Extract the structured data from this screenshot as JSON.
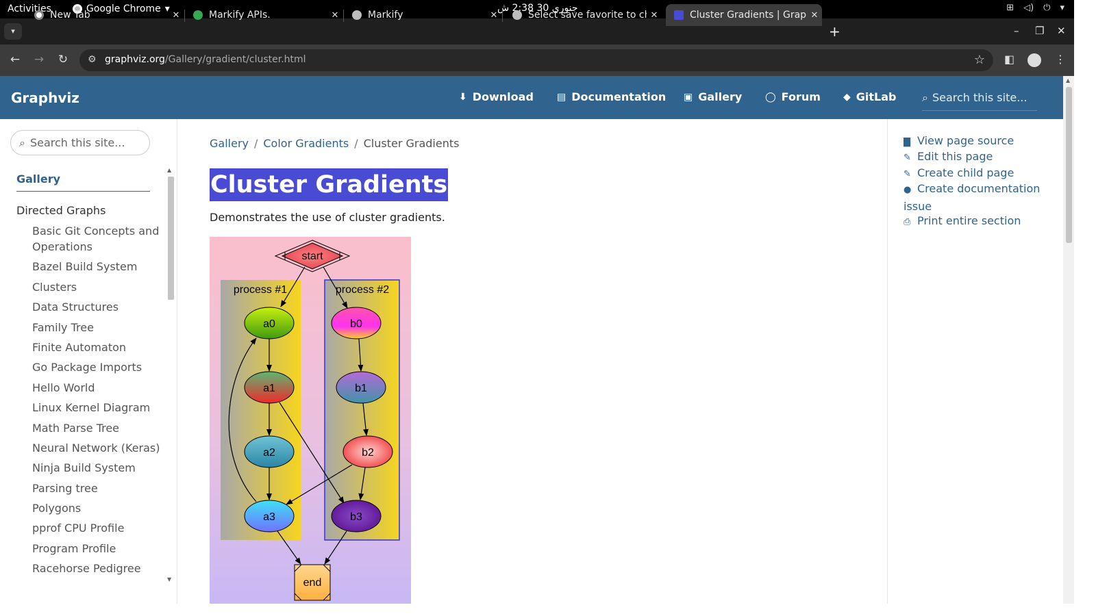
{
  "system": {
    "activities": "Activities",
    "app_name": "Google Chrome",
    "clock": "جنوری 30  2:38 ش"
  },
  "tabs": [
    {
      "title": "New Tab",
      "favicon_color": "#ffffff"
    },
    {
      "title": "Markify APIs.",
      "favicon_color": "#34a853"
    },
    {
      "title": "Markify",
      "favicon_color": "#bdbdbd"
    },
    {
      "title": "Select save favorite to ch",
      "favicon_color": "#bdbdbd"
    },
    {
      "title": "Cluster Gradients | Grapl",
      "favicon_color": "#4a4bd4"
    }
  ],
  "toolbar": {
    "url_host": "graphviz.org",
    "url_path": "/Gallery/gradient/cluster.html"
  },
  "site": {
    "brand": "Graphviz",
    "nav": [
      {
        "label": "Download",
        "icon": "download-icon"
      },
      {
        "label": "Documentation",
        "icon": "book-icon"
      },
      {
        "label": "Gallery",
        "icon": "images-icon"
      },
      {
        "label": "Forum",
        "icon": "chat-icon"
      },
      {
        "label": "GitLab",
        "icon": "gitlab-icon"
      }
    ],
    "search_placeholder": "Search this site..."
  },
  "sidebar": {
    "search_placeholder": "Search this site...",
    "section": "Gallery",
    "group": "Directed Graphs",
    "items": [
      "Basic Git Concepts and Operations",
      "Bazel Build System",
      "Clusters",
      "Data Structures",
      "Family Tree",
      "Finite Automaton",
      "Go Package Imports",
      "Hello World",
      "Linux Kernel Diagram",
      "Math Parse Tree",
      "Neural Network (Keras)",
      "Ninja Build System",
      "Parsing tree",
      "Polygons",
      "pprof CPU Profile",
      "Program Profile",
      "Racehorse Pedigree"
    ]
  },
  "main": {
    "breadcrumb": [
      "Gallery",
      "Color Gradients",
      "Cluster Gradients"
    ],
    "title": "Cluster Gradients",
    "lead": "Demonstrates the use of cluster gradients.",
    "graph": {
      "clusters": [
        "process #1",
        "process #2"
      ],
      "nodes": [
        "start",
        "a0",
        "a1",
        "a2",
        "a3",
        "b0",
        "b1",
        "b2",
        "b3",
        "end"
      ]
    }
  },
  "toc": [
    {
      "label": "View page source",
      "icon": "file-icon"
    },
    {
      "label": "Edit this page",
      "icon": "edit-icon"
    },
    {
      "label": "Create child page",
      "icon": "edit-icon"
    },
    {
      "label": "Create documentation issue",
      "icon": "github-icon"
    },
    {
      "label": "Print entire section",
      "icon": "print-icon"
    }
  ],
  "colors": {
    "site_header": "#30638e",
    "title_highlight": "#4a4bd4",
    "link": "#30638e"
  }
}
